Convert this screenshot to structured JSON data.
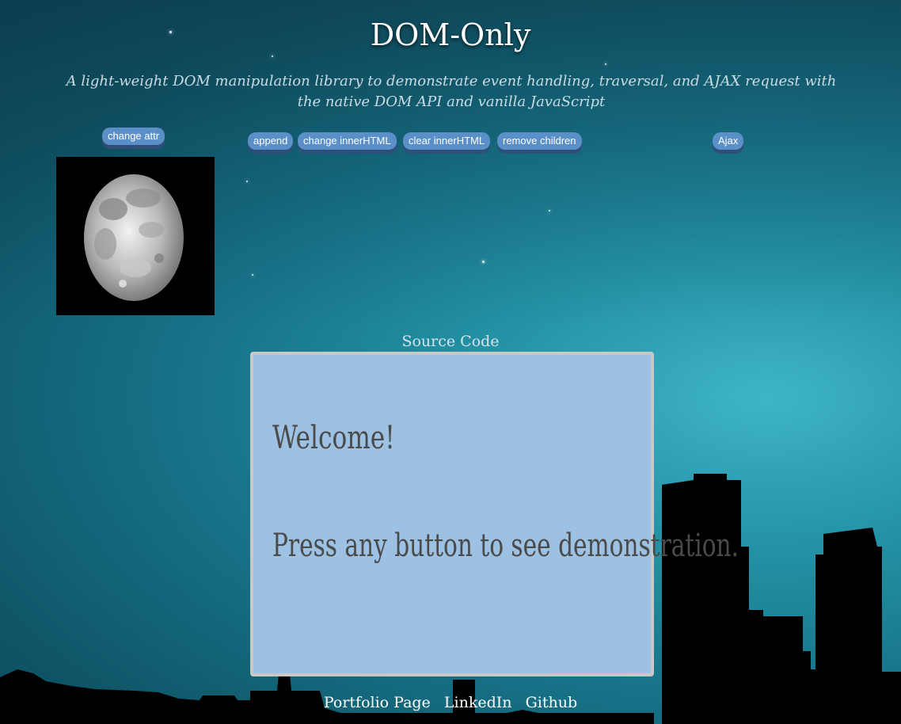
{
  "header": {
    "title": "DOM-Only",
    "subtitle": "A light-weight DOM manipulation library to demonstrate event handling, traversal, and AJAX request with the native DOM API and vanilla JavaScript"
  },
  "buttons": {
    "change_attr": "change attr",
    "append": "append",
    "change_inner_html": "change innerHTML",
    "clear_inner_html": "clear innerHTML",
    "remove_children": "remove children",
    "ajax": "Ajax"
  },
  "source": {
    "label": "Source Code",
    "welcome": "Welcome!",
    "instruction": "Press any button to see demonstration."
  },
  "footer": {
    "links": [
      "Portfolio Page",
      "LinkedIn",
      "Github"
    ]
  },
  "colors": {
    "button_bg": "#5b8fc8",
    "panel_bg": "#9dc1e2",
    "sky": "#18768c"
  }
}
